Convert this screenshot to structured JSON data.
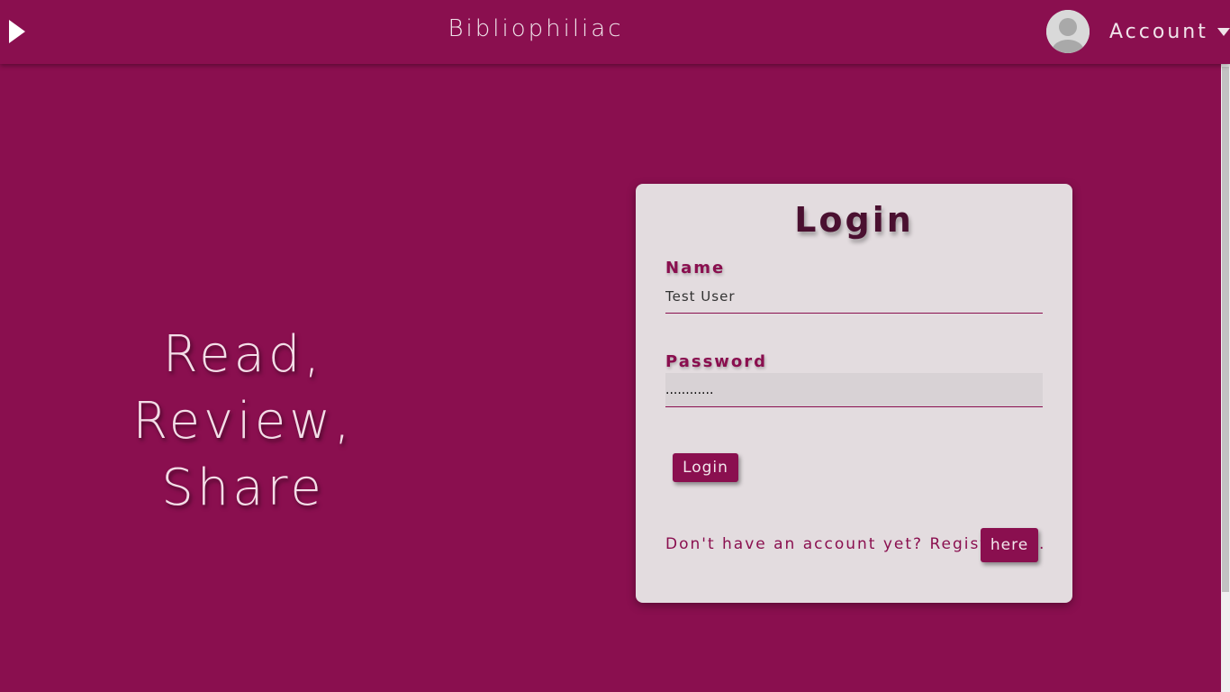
{
  "header": {
    "brand": "Bibliophiliac",
    "account_label": "Account",
    "toggle_icon": "play-triangle-icon",
    "avatar_icon": "user-avatar-icon",
    "caret_icon": "caret-down-icon"
  },
  "hero": {
    "tagline": "Read, Review, Share"
  },
  "login": {
    "title": "Login",
    "name_label": "Name",
    "name_value": "Test User",
    "password_label": "Password",
    "password_value": "............",
    "submit_label": "Login",
    "register_text": "Don't have an account yet? Register",
    "register_link": "here",
    "register_period": "."
  },
  "colors": {
    "brand": "#8a0f4f",
    "card_bg": "#e3dcdf",
    "title": "#4a1030"
  }
}
